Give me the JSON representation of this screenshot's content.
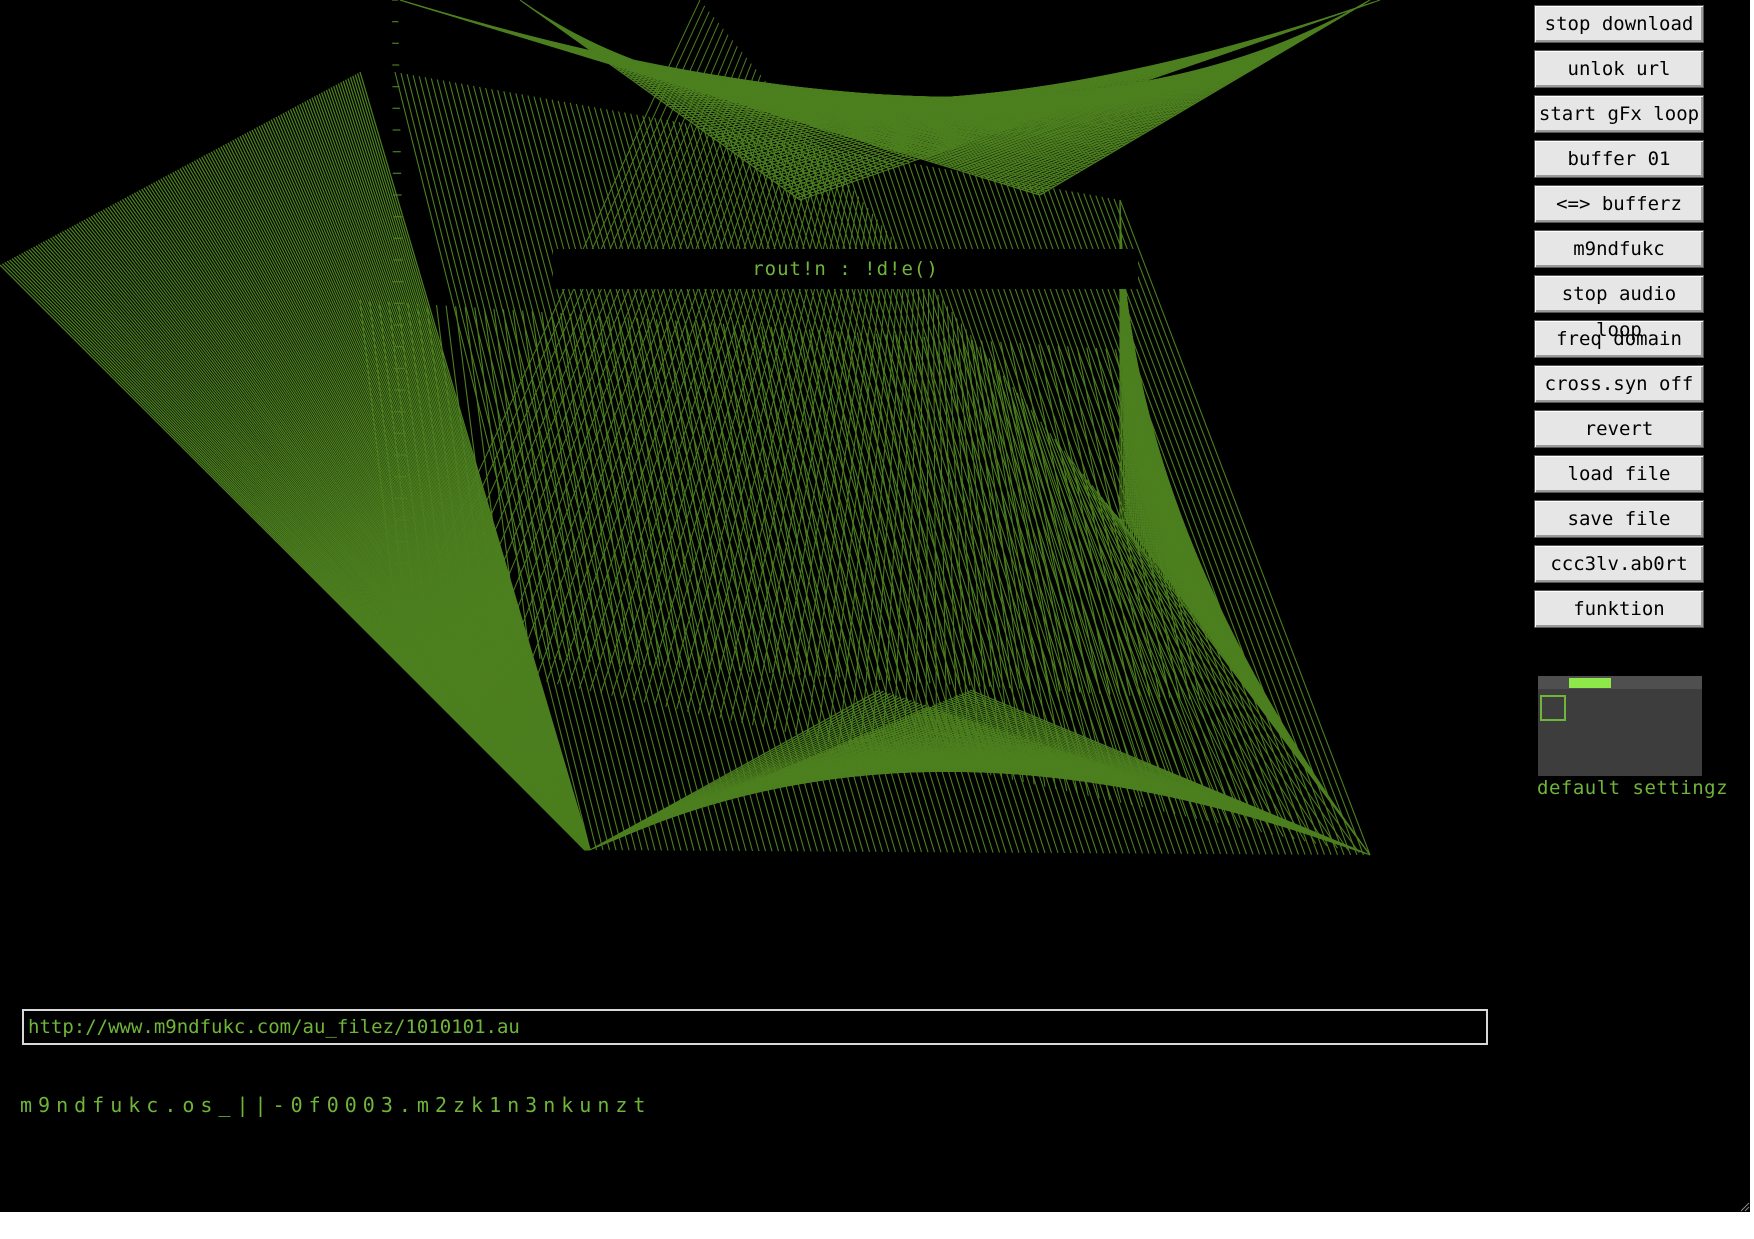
{
  "status": {
    "text": "rout!n : !d!e()"
  },
  "buttons": [
    {
      "id": "stop-download",
      "label": "stop download"
    },
    {
      "id": "unlok-url",
      "label": "unlok url"
    },
    {
      "id": "start-gfx-loop",
      "label": "start gFx loop"
    },
    {
      "id": "buffer",
      "label": "buffer 01"
    },
    {
      "id": "bufferz",
      "label": "<=> bufferz"
    },
    {
      "id": "m9ndfukc",
      "label": "m9ndfukc"
    },
    {
      "id": "stop-audio-loop",
      "label": "stop audio loop"
    },
    {
      "id": "freq-domain",
      "label": "freq domain"
    },
    {
      "id": "cross-syn",
      "label": "cross.syn off"
    },
    {
      "id": "revert",
      "label": "revert"
    },
    {
      "id": "load-file",
      "label": "load file"
    },
    {
      "id": "save-file",
      "label": "save file"
    },
    {
      "id": "ccc3lv-abort",
      "label": "ccc3lv.ab0rt"
    },
    {
      "id": "funktion",
      "label": "funktion"
    }
  ],
  "settings": {
    "label": "default settingz",
    "slider_position": 0.25
  },
  "url": {
    "value": "http://www.m9ndfukc.com/au_filez/1010101.au"
  },
  "footer": {
    "text": "m9ndfukc.os_||-0f0003.m2zk1n3nkunzt"
  },
  "colors": {
    "background": "#000000",
    "accent": "#6fb53a",
    "graphics": "#4c7f1f",
    "button_face": "#e6e6e6"
  }
}
